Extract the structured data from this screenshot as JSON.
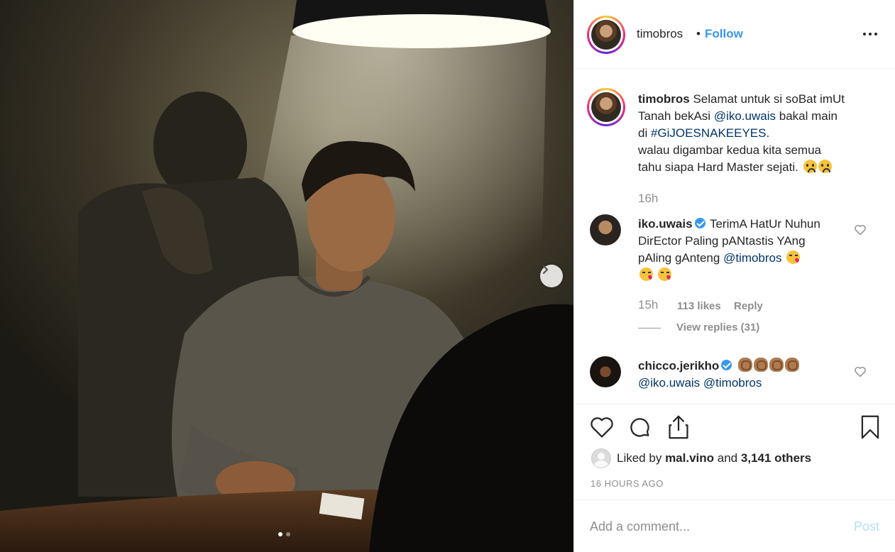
{
  "post": {
    "username": "timobros",
    "separator": "•",
    "follow_label": "Follow",
    "more_icon": "more-options-icon",
    "carousel_dots": 2,
    "carousel_active": 0
  },
  "caption": {
    "username": "timobros",
    "line1": "Selamat untuk si soBat imUt",
    "line2a": "Tanah bekAsi",
    "mention": "@iko.uwais",
    "line2b": "bakal main",
    "line3a": "di",
    "hashtag": "#GiJOESNAKEEYES",
    "line3b": ".",
    "line4": "walau digambar kedua kita semua",
    "line5": "tahu siapa Hard Master sejati.",
    "time": "16h"
  },
  "comments": [
    {
      "username": "iko.uwais",
      "verified": true,
      "line1": "TerimA HatUr Nuhun",
      "line2": "DirEctor Paling pANtastis YAng",
      "line3": "pAling gAnteng",
      "mention": "@timobros",
      "time": "15h",
      "likes": "113 likes",
      "reply_label": "Reply",
      "view_replies": "View replies (31)"
    },
    {
      "username": "chicco.jerikho",
      "verified": true,
      "mention1": "@iko.uwais",
      "mention2": "@timobros"
    }
  ],
  "likes": {
    "prefix": "Liked by",
    "user": "mal.vino",
    "and": "and",
    "others": "3,141 others"
  },
  "timestamp": "16 HOURS AGO",
  "comment_box": {
    "placeholder": "Add a comment...",
    "post_label": "Post"
  },
  "colors": {
    "accent": "#3897f0",
    "link": "#003569",
    "muted": "#8e8e8e",
    "post_disabled": "#b2dffc"
  }
}
